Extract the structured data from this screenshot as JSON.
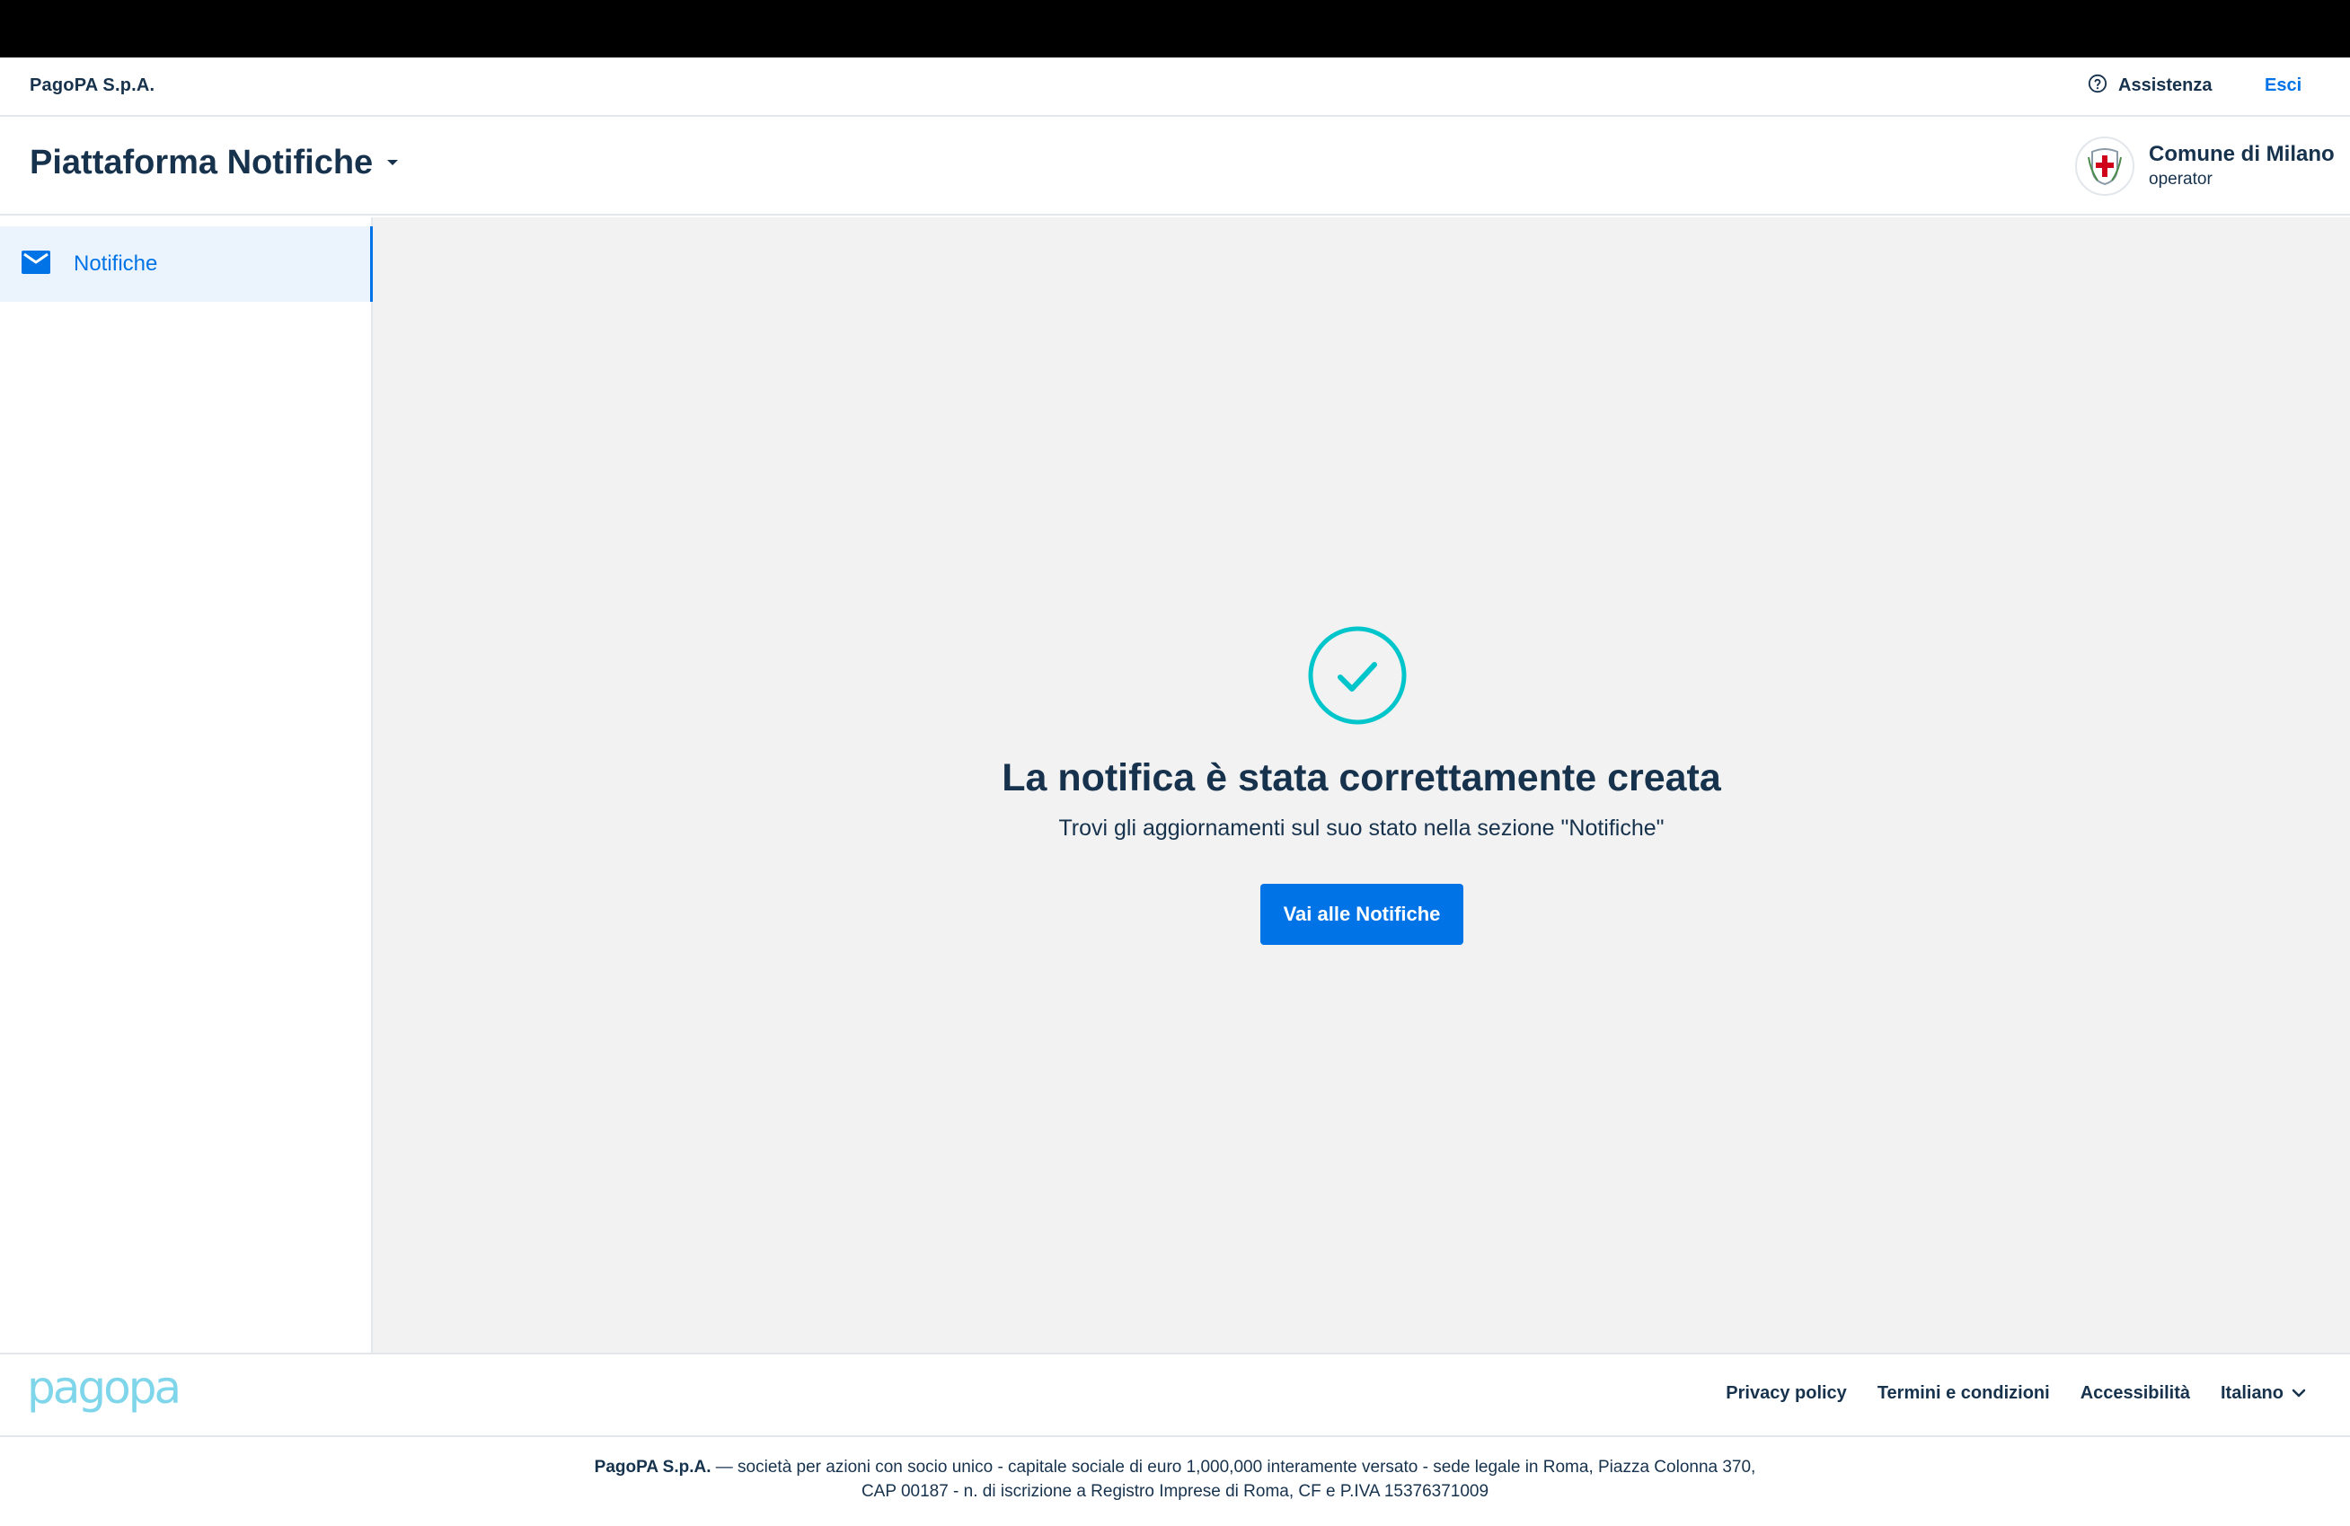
{
  "header": {
    "company": "PagoPA S.p.A.",
    "assist_label": "Assistenza",
    "logout_label": "Esci",
    "product_title": "Piattaforma Notifiche",
    "party_name": "Comune di Milano",
    "party_role": "operator"
  },
  "sidebar": {
    "items": [
      {
        "label": "Notifiche",
        "icon": "mail-icon",
        "selected": true
      }
    ]
  },
  "main": {
    "title": "La notifica è stata correttamente creata",
    "subtitle": "Trovi gli aggiornamenti sul suo stato nella sezione \"Notifiche\"",
    "cta_label": "Vai alle Notifiche",
    "success_color": "#00C5CA"
  },
  "footer": {
    "logo_text": "pagopa",
    "links": [
      "Privacy policy",
      "Termini e condizioni",
      "Accessibilità"
    ],
    "language": "Italiano",
    "legal_company": "PagoPA S.p.A.",
    "legal_line1": " — società per azioni con socio unico - capitale sociale di euro 1,000,000 interamente versato - sede legale in Roma, Piazza Colonna 370,",
    "legal_line2": "CAP 00187 - n. di iscrizione a Registro Imprese di Roma, CF e P.IVA 15376371009"
  },
  "colors": {
    "primary": "#0073E6",
    "text": "#17324D",
    "background": "#F2F2F2"
  }
}
